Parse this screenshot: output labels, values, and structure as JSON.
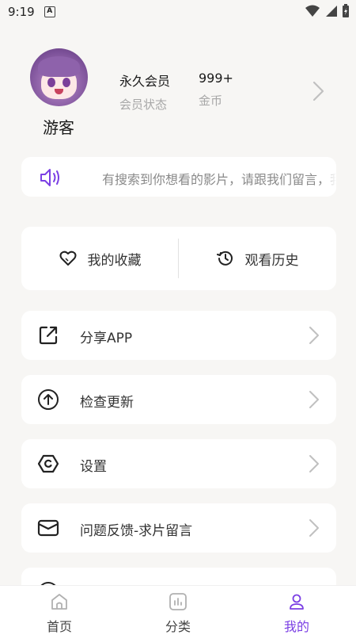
{
  "status_bar": {
    "time": "9:19",
    "notification_badge": "A"
  },
  "profile": {
    "username": "游客",
    "membership_value": "永久会员",
    "membership_label": "会员状态",
    "coins_value": "999+",
    "coins_label": "金币"
  },
  "notice": {
    "text": "有搜索到你想看的影片，请跟我们留言，我"
  },
  "quick_actions": {
    "favorites": "我的收藏",
    "history": "观看历史"
  },
  "menu": [
    {
      "label": "分享APP",
      "icon": "share-icon"
    },
    {
      "label": "检查更新",
      "icon": "arrow-up-circle-icon"
    },
    {
      "label": "设置",
      "icon": "settings-icon"
    },
    {
      "label": "问题反馈-求片留言",
      "icon": "message-icon"
    }
  ],
  "tabs": [
    {
      "label": "首页",
      "icon": "home-icon"
    },
    {
      "label": "分类",
      "icon": "category-icon"
    },
    {
      "label": "我的",
      "icon": "user-icon",
      "active": true
    }
  ],
  "colors": {
    "accent": "#7b3fe4",
    "background": "#f7f6f4"
  }
}
